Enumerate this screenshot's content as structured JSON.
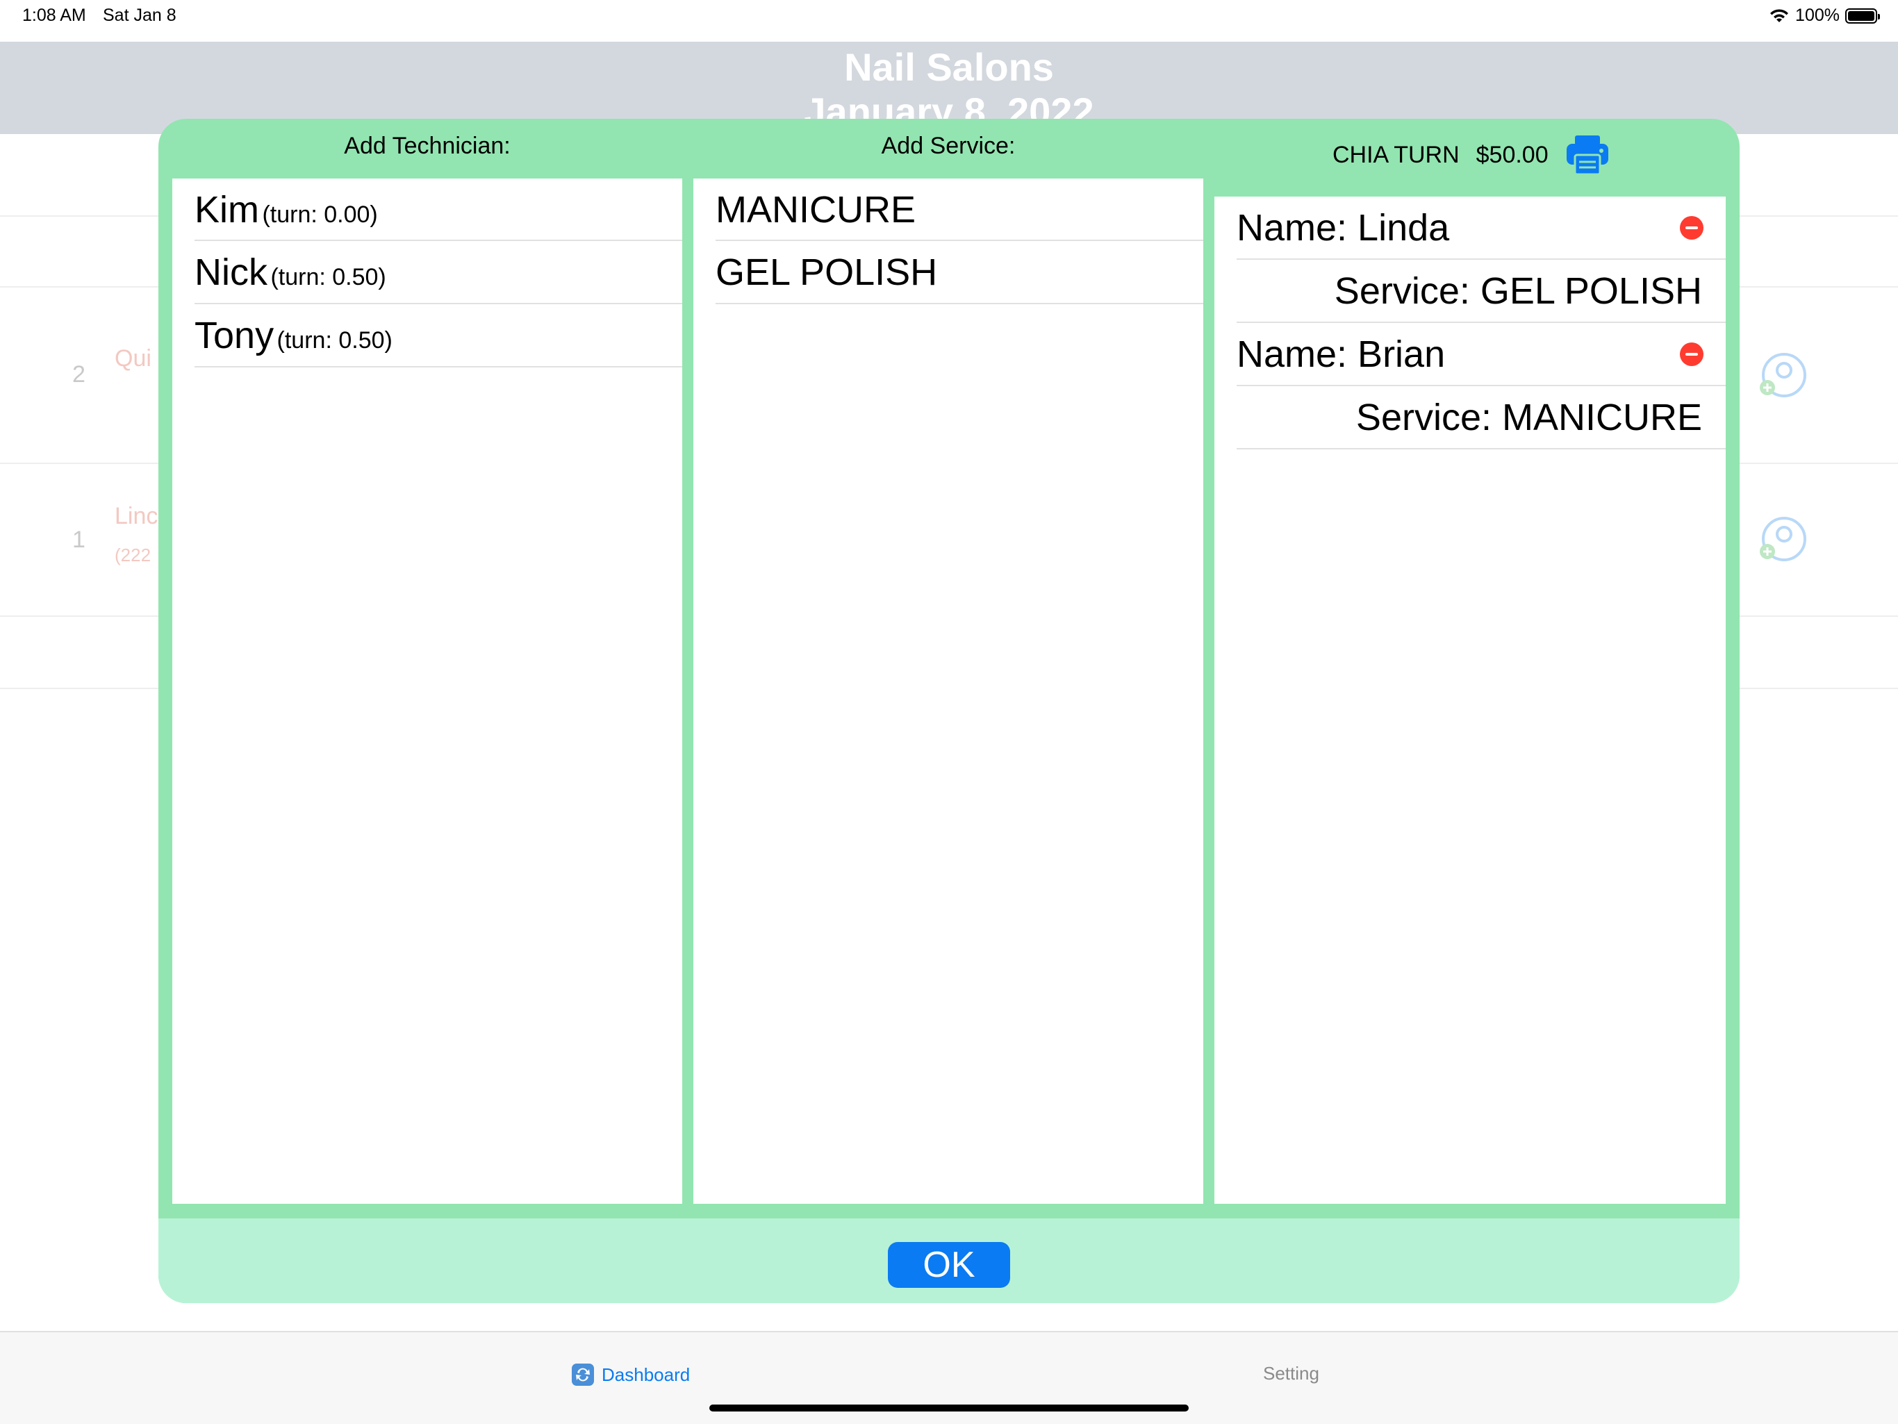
{
  "status_bar": {
    "time": "1:08 AM",
    "date": "Sat Jan 8",
    "battery": "100%"
  },
  "header": {
    "title": "Nail Salons",
    "date": "January 8, 2022"
  },
  "background_list": [
    {
      "number": "2",
      "name": "Qui",
      "subtitle": ""
    },
    {
      "number": "1",
      "name": "Linc",
      "subtitle": "(222"
    }
  ],
  "modal": {
    "technician_header": "Add Technician:",
    "service_header": "Add Service:",
    "chia_turn_label": "CHIA TURN",
    "chia_turn_amount": "$50.00",
    "technicians": [
      {
        "name": "Kim",
        "turn": "(turn: 0.00)"
      },
      {
        "name": "Nick",
        "turn": "(turn: 0.50)"
      },
      {
        "name": "Tony",
        "turn": "(turn: 0.50)"
      }
    ],
    "services": [
      "MANICURE",
      "GEL POLISH"
    ],
    "assignments": [
      {
        "name": "Name: Linda",
        "service": "Service: GEL POLISH"
      },
      {
        "name": "Name: Brian",
        "service": "Service: MANICURE"
      }
    ],
    "ok_label": "OK"
  },
  "tab_bar": {
    "tabs": [
      {
        "label": "Dashboard",
        "active": true
      },
      {
        "label": "Setting",
        "active": false
      }
    ]
  },
  "colors": {
    "accent": "#0a7bf2",
    "modal_bg": "#92e5b0",
    "modal_footer": "#b8f2d6",
    "remove": "#ff3b30"
  }
}
